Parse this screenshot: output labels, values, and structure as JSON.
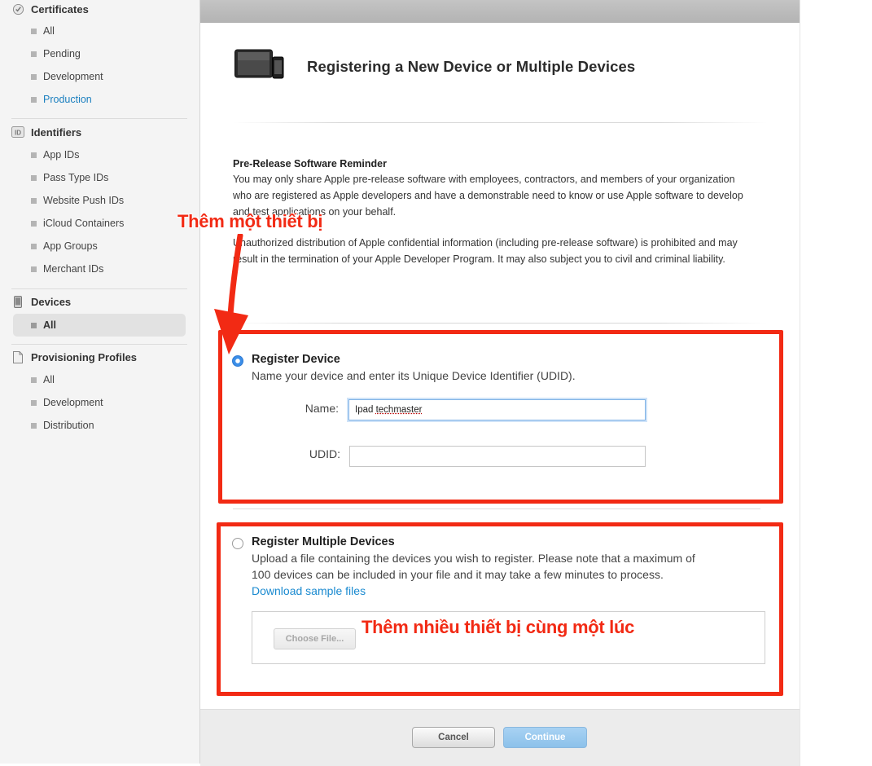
{
  "sidebar": {
    "certificates": {
      "title": "Certificates",
      "icon": "certificate-gear-icon",
      "items": [
        {
          "label": "All"
        },
        {
          "label": "Pending"
        },
        {
          "label": "Development"
        },
        {
          "label": "Production",
          "style": "link"
        }
      ]
    },
    "identifiers": {
      "title": "Identifiers",
      "icon": "id-badge-icon",
      "icon_text": "ID",
      "items": [
        {
          "label": "App IDs"
        },
        {
          "label": "Pass Type IDs"
        },
        {
          "label": "Website Push IDs"
        },
        {
          "label": "iCloud Containers"
        },
        {
          "label": "App Groups"
        },
        {
          "label": "Merchant IDs"
        }
      ]
    },
    "devices": {
      "title": "Devices",
      "icon": "iphone-icon",
      "items": [
        {
          "label": "All",
          "selected": true
        }
      ]
    },
    "provisioning": {
      "title": "Provisioning Profiles",
      "icon": "document-icon",
      "items": [
        {
          "label": "All"
        },
        {
          "label": "Development"
        },
        {
          "label": "Distribution"
        }
      ]
    }
  },
  "main": {
    "header_icon": "ipad-iphone-icon",
    "title": "Registering a New Device or Multiple Devices",
    "reminder_title": "Pre-Release Software Reminder",
    "reminder_p1": "You may only share Apple pre-release software with employees, contractors, and members of your organization who are registered as Apple developers and have a demonstrable need to know or use Apple software to develop and test applications on your behalf.",
    "reminder_p2": "Unauthorized distribution of Apple confidential information (including pre-release software) is prohibited and may result in the termination of your Apple Developer Program. It may also subject you to civil and criminal liability.",
    "register_device": {
      "selected": true,
      "title": "Register Device",
      "description": "Name your device and enter its Unique Device Identifier (UDID).",
      "name_label": "Name:",
      "name_value_plain": "Ipad ",
      "name_value_underlined": "techmaster",
      "udid_label": "UDID:",
      "udid_value": ""
    },
    "register_multiple": {
      "selected": false,
      "title": "Register Multiple Devices",
      "description_line1": "Upload a file containing the devices you wish to register. Please note that a maximum of",
      "description_line2": "100 devices can be included in your file and it may take a few minutes to process.",
      "download_link": "Download sample files",
      "choose_file": "Choose File..."
    },
    "buttons": {
      "cancel": "Cancel",
      "continue": "Continue"
    }
  },
  "annotations": {
    "color": "#f22a14",
    "single_device": "Thêm một thiết bị",
    "multiple_devices": "Thêm nhiều thiết bị cùng một lúc"
  },
  "colors": {
    "accent_link": "#1a8ad0",
    "continue_button": "#8cc1ea",
    "annotation_red": "#f22a14"
  }
}
